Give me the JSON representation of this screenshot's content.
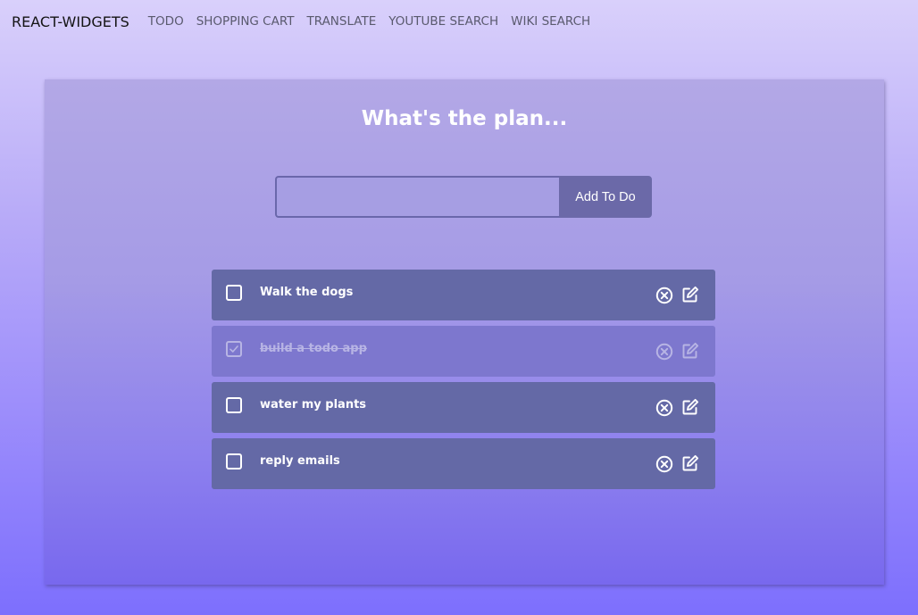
{
  "nav": {
    "brand": "REACT-WIDGETS",
    "links": [
      {
        "label": "TODO"
      },
      {
        "label": "SHOPPING CART"
      },
      {
        "label": "TRANSLATE"
      },
      {
        "label": "YOUTUBE SEARCH"
      },
      {
        "label": "WIKI SEARCH"
      }
    ]
  },
  "main": {
    "title": "What's the plan...",
    "input_value": "",
    "add_label": "Add To Do"
  },
  "todos": [
    {
      "text": "Walk the dogs",
      "completed": false
    },
    {
      "text": "build a todo app",
      "completed": true
    },
    {
      "text": "water my plants",
      "completed": false
    },
    {
      "text": "reply emails",
      "completed": false
    }
  ],
  "icons": {
    "delete": "circle-x-icon",
    "edit": "pencil-square-icon",
    "check": "checkmark-icon"
  },
  "colors": {
    "item_bg": "#6469a6",
    "item_done_bg": "#7d77ce",
    "button_bg": "#6b69a8",
    "text": "#ffffff"
  }
}
